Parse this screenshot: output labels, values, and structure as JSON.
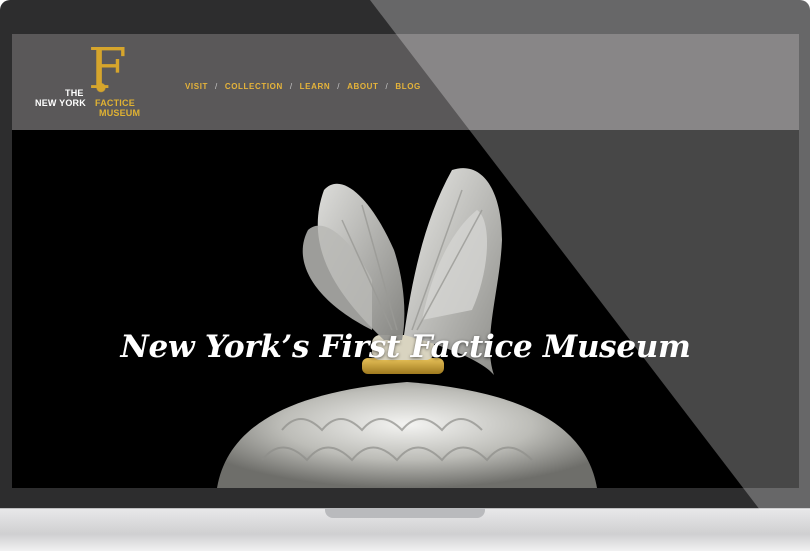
{
  "logo": {
    "line1": "THE",
    "line2": "NEW YORK",
    "line2_accent": "FACTICE",
    "line3": "MUSEUM",
    "monogram": "F"
  },
  "nav": {
    "items": [
      "VISIT",
      "COLLECTION",
      "LEARN",
      "ABOUT",
      "BLOG"
    ],
    "separator": "/"
  },
  "hero": {
    "title": "New York’s First Factice Museum"
  },
  "colors": {
    "header_bg": "#5a5859",
    "accent_gold": "#e0b233",
    "bezel": "#2d2d2e"
  }
}
